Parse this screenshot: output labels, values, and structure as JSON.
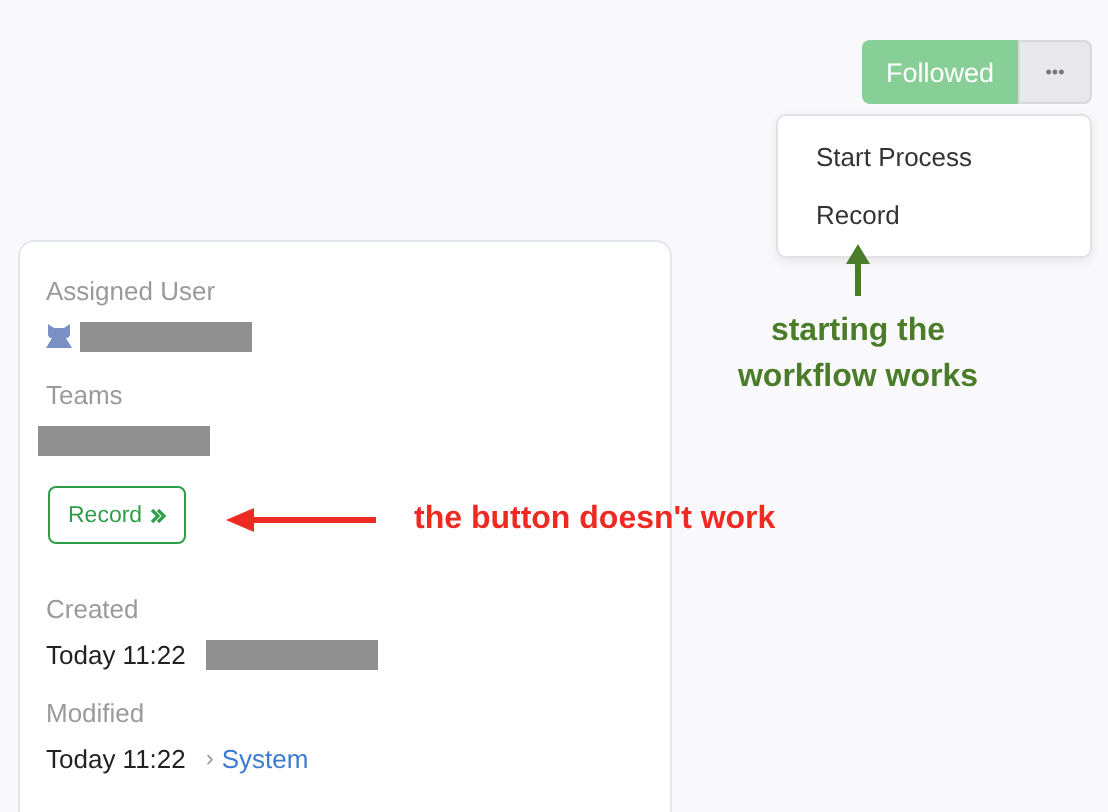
{
  "header_actions": {
    "follow_button": {
      "label": "Followed",
      "selected": true
    },
    "more_button": {
      "label": "•••"
    }
  },
  "dropdown_menu": {
    "items": [
      {
        "label": "Start Process"
      },
      {
        "label": "Record"
      }
    ]
  },
  "details": {
    "fields": [
      {
        "kind": "user",
        "label": "Assigned User"
      },
      {
        "kind": "team",
        "label": "Teams"
      },
      {
        "kind": "button",
        "label": "Record"
      },
      {
        "kind": "date",
        "label": "Created",
        "value": "Today 11:22"
      },
      {
        "kind": "date_user",
        "label": "Modified",
        "value": "Today 11:22",
        "separator": "›",
        "user": "System"
      }
    ]
  },
  "annotations": [
    {
      "kind": "up",
      "color": "#4a7c2a",
      "text": "starting the workflow works"
    },
    {
      "kind": "left",
      "color": "#ee2a22",
      "text": "the button doesn't work"
    }
  ]
}
